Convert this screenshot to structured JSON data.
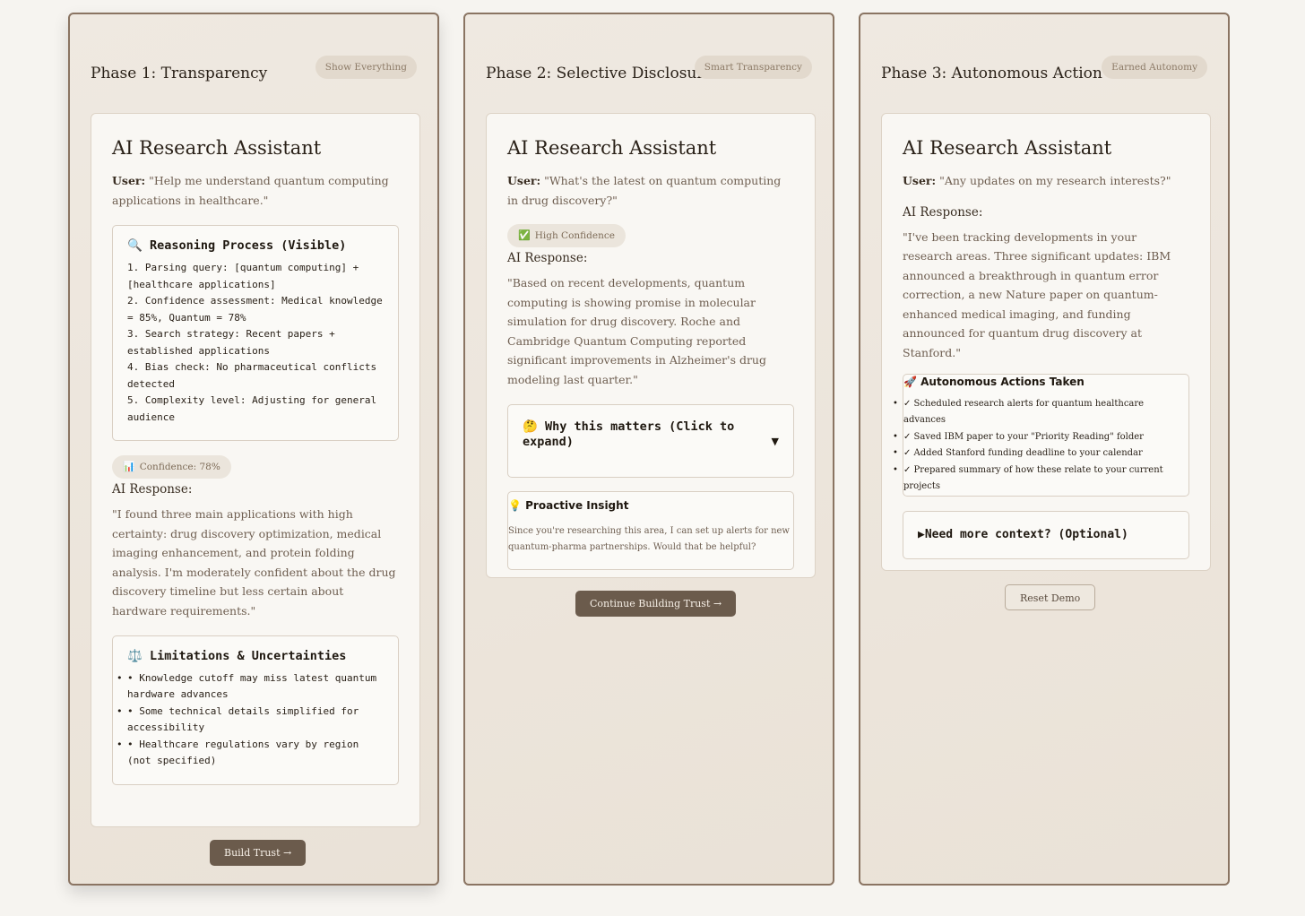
{
  "phases": [
    {
      "title": "Phase 1: Transparency",
      "badge": "Show Everything",
      "card_title": "AI Research Assistant",
      "user_label": "User:",
      "user_query": "\"Help me understand quantum computing applications in healthcare.\"",
      "reasoning": {
        "icon": "🔍",
        "title": "Reasoning Process (Visible)",
        "steps": [
          "1. Parsing query: [quantum computing] + [healthcare applications]",
          "2. Confidence assessment: Medical knowledge = 85%, Quantum = 78%",
          "3. Search strategy: Recent papers + established applications",
          "4. Bias check: No pharmaceutical conflicts detected",
          "5. Complexity level: Adjusting for general audience"
        ]
      },
      "confidence": {
        "icon": "📊",
        "label": "Confidence: 78%"
      },
      "response_label": "AI Response:",
      "response_text": "\"I found three main applications with high certainty: drug discovery optimization, medical imaging enhancement, and protein folding analysis. I'm moderately confident about the drug discovery timeline but less certain about hardware requirements.\"",
      "limitations": {
        "icon": "⚖️",
        "title": "Limitations & Uncertainties",
        "items": [
          "• Knowledge cutoff may miss latest quantum hardware advances",
          "• Some technical details simplified for accessibility",
          "• Healthcare regulations vary by region (not specified)"
        ]
      },
      "button": "Build Trust →"
    },
    {
      "title": "Phase 2: Selective Disclosure",
      "badge": "Smart Transparency",
      "card_title": "AI Research Assistant",
      "user_label": "User:",
      "user_query": "\"What's the latest on quantum computing in drug discovery?\"",
      "confidence": {
        "icon": "✅",
        "label": "High Confidence"
      },
      "response_label": "AI Response:",
      "response_text": "\"Based on recent developments, quantum computing is showing promise in molecular simulation for drug discovery. Roche and Cambridge Quantum Computing reported significant improvements in Alzheimer's drug modeling last quarter.\"",
      "why": {
        "icon": "🤔",
        "label": "Why this matters (Click to expand)",
        "arrow": "▼"
      },
      "insight": {
        "icon": "💡",
        "title": "Proactive Insight",
        "text": "Since you're researching this area, I can set up alerts for new quantum-pharma partnerships. Would that be helpful?"
      },
      "button": "Continue Building Trust →"
    },
    {
      "title": "Phase 3: Autonomous Action",
      "badge": "Earned Autonomy",
      "card_title": "AI Research Assistant",
      "user_label": "User:",
      "user_query": "\"Any updates on my research interests?\"",
      "response_label": "AI Response:",
      "response_text": "\"I've been tracking developments in your research areas. Three significant updates: IBM announced a breakthrough in quantum error correction, a new Nature paper on quantum-enhanced medical imaging, and funding announced for quantum drug discovery at Stanford.\"",
      "actions": {
        "icon": "🚀",
        "title": "Autonomous Actions Taken",
        "items": [
          "✓ Scheduled research alerts for quantum healthcare advances",
          "✓ Saved IBM paper to your \"Priority Reading\" folder",
          "✓ Added Stanford funding deadline to your calendar",
          "✓ Prepared summary of how these relate to your current projects"
        ]
      },
      "context": {
        "arrow": "▶",
        "label": "Need more context? (Optional)"
      },
      "button": "Reset Demo"
    }
  ]
}
